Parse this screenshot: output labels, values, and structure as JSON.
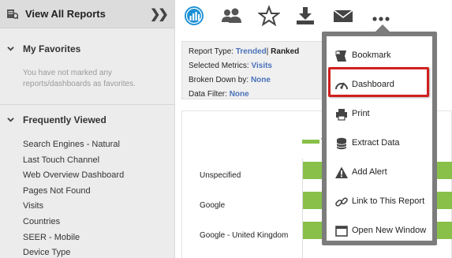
{
  "sidebar": {
    "title": "View All Reports",
    "collapse_icon": "double-chevron-right-icon",
    "favorites": {
      "label": "My Favorites",
      "empty_text": "You have not marked any reports/dashboards as favorites."
    },
    "frequently_viewed": {
      "label": "Frequently Viewed",
      "items": [
        "Search Engines - Natural",
        "Last Touch Channel",
        "Web Overview Dashboard",
        "Pages Not Found",
        "Visits",
        "Countries",
        "SEER - Mobile",
        "Device Type"
      ]
    }
  },
  "toolbar": {
    "icons": [
      "analytics-icon",
      "users-icon",
      "star-icon",
      "download-icon",
      "mail-icon",
      "more-icon"
    ],
    "accent": "#1a8fd6"
  },
  "report_info": {
    "report_type_label": "Report Type:",
    "report_type_value": "Trended",
    "report_type_sep": "|",
    "report_type_alt": "Ranked",
    "metrics_label": "Selected Metrics:",
    "metrics_value": "Visits",
    "broken_down_label": "Broken Down by:",
    "broken_down_value": "None",
    "filter_label": "Data Filter:",
    "filter_value": "None"
  },
  "chart_data": {
    "type": "bar",
    "orientation": "horizontal",
    "categories": [
      "Unspecified",
      "Google",
      "Google - United Kingdom"
    ],
    "series": [
      {
        "values": [
          100,
          100,
          100
        ]
      }
    ],
    "legend_text": "V",
    "bar_color": "#88c04a"
  },
  "menu": {
    "items": [
      {
        "label": "Bookmark",
        "icon": "bookmark-icon"
      },
      {
        "label": "Dashboard",
        "icon": "dashboard-icon"
      },
      {
        "label": "Print",
        "icon": "print-icon"
      },
      {
        "label": "Extract Data",
        "icon": "database-icon"
      },
      {
        "label": "Add Alert",
        "icon": "alert-icon"
      },
      {
        "label": "Link to This Report",
        "icon": "link-icon"
      },
      {
        "label": "Open New Window",
        "icon": "window-icon"
      }
    ],
    "highlight_color": "#d11f1f"
  }
}
